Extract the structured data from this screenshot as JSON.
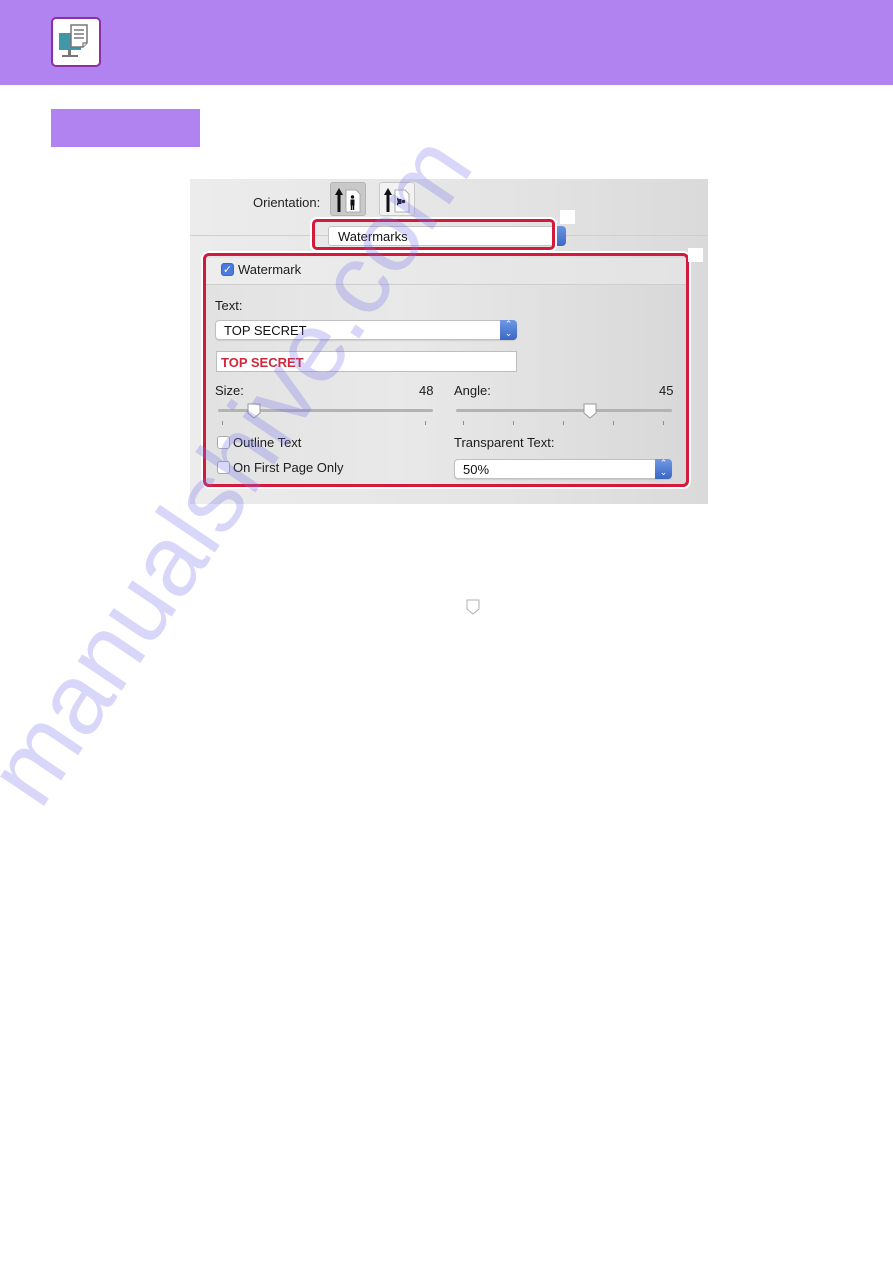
{
  "page": {
    "brand_color": "#b183f0",
    "header_icon": "computer-print-document-icon"
  },
  "dialog": {
    "orientation": {
      "label": "Orientation:",
      "options": [
        "portrait-icon",
        "landscape-icon"
      ],
      "selected": "portrait"
    },
    "panel_menu": {
      "selected": "Watermarks"
    },
    "watermark": {
      "enabled_label": "Watermark",
      "enabled": true,
      "text_label": "Text:",
      "text_selected": "TOP SECRET",
      "text_value": "TOP SECRET",
      "text_color": "#d0283a",
      "size": {
        "label": "Size:",
        "value": "48"
      },
      "angle": {
        "label": "Angle:",
        "value": "45"
      },
      "outline_text": {
        "label": "Outline Text",
        "checked": false
      },
      "first_page_only": {
        "label": "On First Page Only",
        "checked": false
      },
      "transparent_text": {
        "label": "Transparent Text:",
        "selected": "50%"
      }
    },
    "highlight_color": "#d41a3c"
  },
  "overlay": {
    "watermark_text": "manualshive.com"
  }
}
